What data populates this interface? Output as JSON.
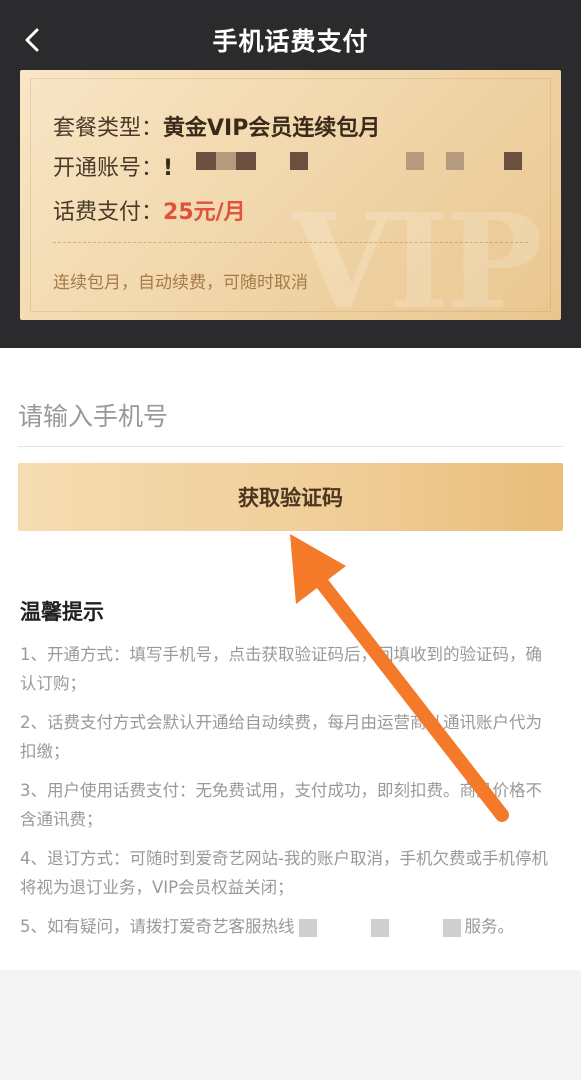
{
  "header": {
    "title": "手机话费支付"
  },
  "order": {
    "package_label": "套餐类型：",
    "package_value": "黄金VIP会员连续包月",
    "account_label": "开通账号：",
    "account_prefix": "!",
    "payment_label": "话费支付：",
    "payment_value": "25元/月",
    "renewal_note": "连续包月，自动续费，可随时取消",
    "watermark": "VIP"
  },
  "form": {
    "phone_placeholder": "请输入手机号",
    "get_code_label": "获取验证码"
  },
  "tips": {
    "title": "温馨提示",
    "items": [
      "1、开通方式：填写手机号，点击获取验证码后，回填收到的验证码，确认订购；",
      "2、话费支付方式会默认开通给自动续费，每月由运营商从通讯账户代为扣缴；",
      "3、用户使用话费支付：无免费试用，支付成功，即刻扣费。商品价格不含通讯费；",
      "4、退订方式：可随时到爱奇艺网站-我的账户取消，手机欠费或手机停机将视为退订业务，VIP会员权益关闭；"
    ],
    "item5_prefix": "5、如有疑问，请拨打爱奇艺客服热线",
    "item5_suffix": "服务。"
  },
  "colors": {
    "header_bg": "#2b2b2d",
    "card_gold": "#f0d5a8",
    "price_red": "#e0523a",
    "button_gold": "#efcd97",
    "arrow_orange": "#f47a2a"
  },
  "icons": {
    "back": "chevron-left-icon"
  }
}
